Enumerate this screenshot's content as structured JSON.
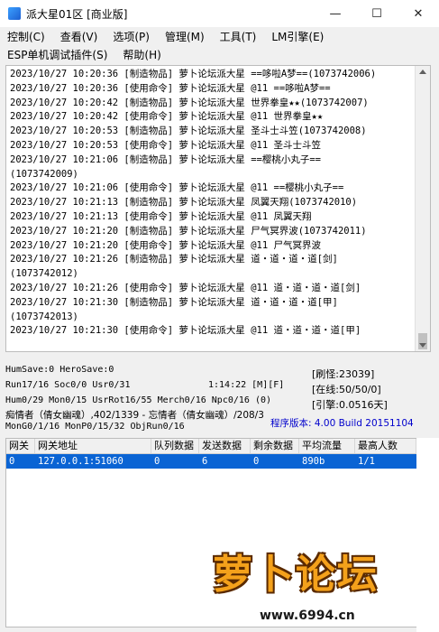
{
  "window": {
    "title": "派大星01区 [商业版]"
  },
  "controls": {
    "minimize": "—",
    "maximize": "☐",
    "close": "✕"
  },
  "menu": {
    "row1": [
      "控制(C)",
      "查看(V)",
      "选项(P)",
      "管理(M)",
      "工具(T)",
      "LM引擎(E)"
    ],
    "row2": [
      "ESP单机调试插件(S)",
      "帮助(H)"
    ]
  },
  "log": [
    "2023/10/27 10:20:36 [制造物品] 萝卜论坛派大星 ==哆啦A梦==(1073742006)",
    "2023/10/27 10:20:36 [使用命令] 萝卜论坛派大星 @11 ==哆啦A梦==",
    "2023/10/27 10:20:42 [制造物品] 萝卜论坛派大星 世界拳皇★★(1073742007)",
    "2023/10/27 10:20:42 [使用命令] 萝卜论坛派大星 @11 世界拳皇★★",
    "2023/10/27 10:20:53 [制造物品] 萝卜论坛派大星 圣斗士斗笠(1073742008)",
    "2023/10/27 10:20:53 [使用命令] 萝卜论坛派大星 @11 圣斗士斗笠",
    "2023/10/27 10:21:06 [制造物品] 萝卜论坛派大星 ==樱桃小丸子==",
    "(1073742009)",
    "2023/10/27 10:21:06 [使用命令] 萝卜论坛派大星 @11 ==樱桃小丸子==",
    "2023/10/27 10:21:13 [制造物品] 萝卜论坛派大星 凤翼天翔(1073742010)",
    "2023/10/27 10:21:13 [使用命令] 萝卜论坛派大星 @11 凤翼天翔",
    "2023/10/27 10:21:20 [制造物品] 萝卜论坛派大星 尸气冥界波(1073742011)",
    "2023/10/27 10:21:20 [使用命令] 萝卜论坛派大星 @11 尸气冥界波",
    "2023/10/27 10:21:26 [制造物品] 萝卜论坛派大星 道・道・道・道[剑]",
    "(1073742012)",
    "2023/10/27 10:21:26 [使用命令] 萝卜论坛派大星 @11 道・道・道・道[剑]",
    "2023/10/27 10:21:30 [制造物品] 萝卜论坛派大星 道・道・道・道[甲]",
    "(1073742013)",
    "2023/10/27 10:21:30 [使用命令] 萝卜论坛派大星 @11 道・道・道・道[甲]"
  ],
  "status": {
    "line1": "HumSave:0 HeroSave:0",
    "line2": "Run17/16 Soc0/0 Usr0/31",
    "time": "1:14:22 [M][F]",
    "line3": "Hum0/29 Mon0/15 UsrRot16/55 Merch0/16 Npc0/16 (0)",
    "line4": "痴情者（倩女幽魂）,402/1339 - 忘情者（倩女幽魂）/208/3",
    "line5": "MonG0/1/16 MonP0/15/32 ObjRun0/16",
    "stats": [
      "[刷怪:23039]",
      "[在线:50/50/0]",
      "[引擎:0.0516天]"
    ],
    "version": "程序版本: 4.00 Build 20151104"
  },
  "table": {
    "headers": [
      "网关",
      "网关地址",
      "队列数据",
      "发送数据",
      "剩余数据",
      "平均流量",
      "最高人数"
    ],
    "rows": [
      [
        "0",
        "127.0.0.1:51060",
        "0",
        "6",
        "0",
        "890b",
        "1/1"
      ]
    ]
  },
  "watermark": {
    "brand": "萝卜论坛",
    "url": "www.6994.cn"
  },
  "colors": {
    "selection": "#0a64d4",
    "version_text": "#0000cc"
  }
}
